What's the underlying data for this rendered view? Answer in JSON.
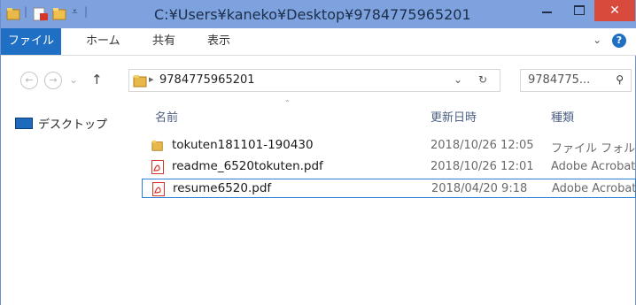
{
  "window": {
    "title": "C:¥Users¥kaneko¥Desktop¥9784775965201",
    "close_glyph": "✕"
  },
  "ribbon": {
    "tabs": [
      "ファイル",
      "ホーム",
      "共有",
      "表示"
    ],
    "expand_glyph": "⌄",
    "help_glyph": "?"
  },
  "nav": {
    "back_glyph": "←",
    "forward_glyph": "→",
    "recent_glyph": "⌄",
    "up_glyph": "↑",
    "breadcrumb_sep": "▸",
    "path": "9784775965201",
    "dropdown_glyph": "⌄",
    "refresh_glyph": "↻",
    "search_placeholder": "9784775...",
    "search_glyph": "⚲"
  },
  "sidebar": {
    "items": [
      {
        "label": "デスクトップ",
        "icon": "desktop-icon"
      }
    ]
  },
  "columns": {
    "name": "名前",
    "date": "更新日時",
    "type": "種類",
    "sort_glyph": "⌃"
  },
  "files": [
    {
      "name": "tokuten181101-190430",
      "date": "2018/10/26 12:05",
      "type": "ファイル フォルダー",
      "icon": "folder-icon"
    },
    {
      "name": "readme_6520tokuten.pdf",
      "date": "2018/10/26 12:01",
      "type": "Adobe Acrobat",
      "icon": "pdf-icon"
    },
    {
      "name": "resume6520.pdf",
      "date": "2018/04/20 9:18",
      "type": "Adobe Acrobat",
      "icon": "pdf-icon",
      "selected": true
    }
  ],
  "colors": {
    "titlebar": "#7ea2de",
    "file_tab": "#1f6fc5",
    "close_button": "#d84a3c",
    "selection_border": "#2b7fd6",
    "folder": "#e8b94a",
    "pdf": "#d8352a"
  }
}
